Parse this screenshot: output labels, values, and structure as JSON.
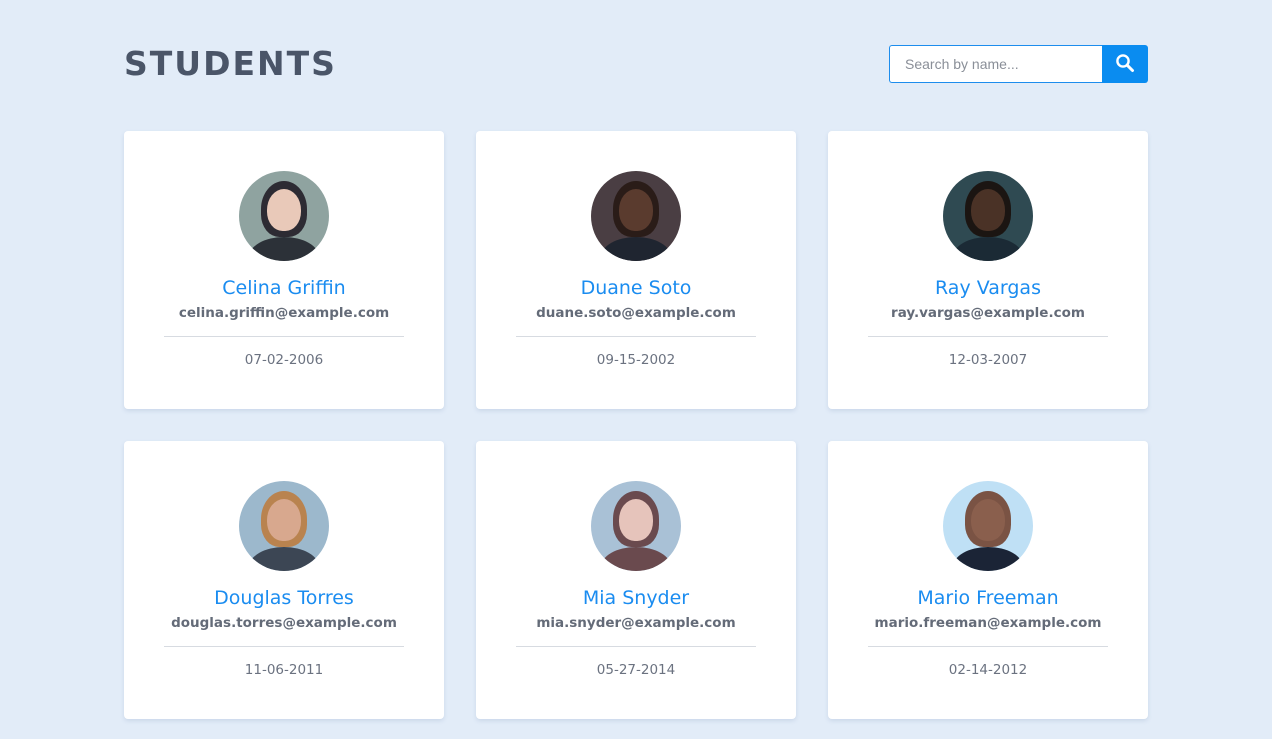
{
  "header": {
    "title": "STUDENTS"
  },
  "search": {
    "placeholder": "Search by name...",
    "value": "",
    "button_icon": "search-icon"
  },
  "colors": {
    "background": "#e2ecf8",
    "accent": "#0a8cf0",
    "name_text": "#1a8cf0",
    "title_text": "#4a5568"
  },
  "students": [
    {
      "name": "Celina Griffin",
      "email": "celina.griffin@example.com",
      "date": "07-02-2006",
      "avatar": {
        "bg": "#8fa3a0",
        "face": "#e9c9b9",
        "hair": "#2d2b33",
        "torso": "#2c3138"
      }
    },
    {
      "name": "Duane Soto",
      "email": "duane.soto@example.com",
      "date": "09-15-2002",
      "avatar": {
        "bg": "#4a3e43",
        "face": "#5a3b2e",
        "hair": "#2a1c18",
        "torso": "#1f2530"
      }
    },
    {
      "name": "Ray Vargas",
      "email": "ray.vargas@example.com",
      "date": "12-03-2007",
      "avatar": {
        "bg": "#2f4a52",
        "face": "#4a3226",
        "hair": "#1b1512",
        "torso": "#1b2a35"
      }
    },
    {
      "name": "Douglas Torres",
      "email": "douglas.torres@example.com",
      "date": "11-06-2011",
      "avatar": {
        "bg": "#9cb8cc",
        "face": "#d8a88e",
        "hair": "#b9834f",
        "torso": "#3c4654"
      }
    },
    {
      "name": "Mia Snyder",
      "email": "mia.snyder@example.com",
      "date": "05-27-2014",
      "avatar": {
        "bg": "#a9c1d6",
        "face": "#e6c4bb",
        "hair": "#6a4a4e",
        "torso": "#6a4a4e"
      }
    },
    {
      "name": "Mario Freeman",
      "email": "mario.freeman@example.com",
      "date": "02-14-2012",
      "avatar": {
        "bg": "#bfe0f5",
        "face": "#8a5f4d",
        "hair": "#7a5344",
        "torso": "#1b2436"
      }
    }
  ]
}
